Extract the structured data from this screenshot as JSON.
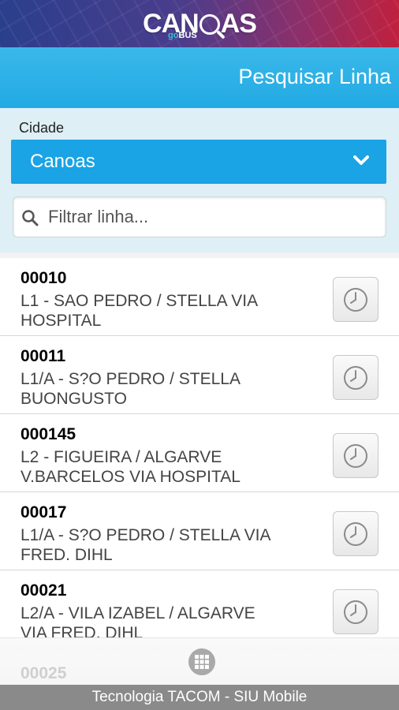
{
  "brand": {
    "logo_text_left": "CAN",
    "logo_text_right": "AS",
    "logo_sub_go": "go",
    "logo_sub_bus": "BUS"
  },
  "header": {
    "title": "Pesquisar Linha"
  },
  "filters": {
    "city_label": "Cidade",
    "city_value": "Canoas",
    "search_placeholder": "Filtrar linha..."
  },
  "lines": [
    {
      "code": "00010",
      "desc_1": "L1 - SAO PEDRO / STELLA VIA",
      "desc_2": "HOSPITAL"
    },
    {
      "code": "00011",
      "desc_1": "L1/A - S?O PEDRO / STELLA",
      "desc_2": "BUONGUSTO"
    },
    {
      "code": "000145",
      "desc_1": "L2 - FIGUEIRA / ALGARVE",
      "desc_2": "V.BARCELOS VIA HOSPITAL"
    },
    {
      "code": "00017",
      "desc_1": "L1/A - S?O PEDRO / STELLA VIA",
      "desc_2": "FRED. DIHL"
    },
    {
      "code": "00021",
      "desc_1": "L2/A - VILA IZABEL  / ALGARVE",
      "desc_2": "VIA FRED. DIHL"
    }
  ],
  "partial_line": {
    "code": "00025"
  },
  "footer": {
    "text": "Tecnologia TACOM - SIU Mobile"
  },
  "icons": {
    "select": "chevron-down-icon",
    "search": "search-icon",
    "schedule": "clock-icon",
    "menu": "grid-icon"
  },
  "colors": {
    "header": "#22aae3",
    "select": "#1aa3e5",
    "footer": "#8a8a8a"
  }
}
